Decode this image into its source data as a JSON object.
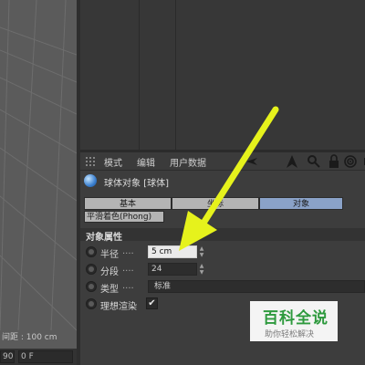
{
  "viewport": {
    "grid_spacing_label": "间距 : 100 cm",
    "bottom_left_value": "90",
    "frame_field": "0 F"
  },
  "attribute_manager": {
    "menu": [
      "模式",
      "编辑",
      "用户数据"
    ],
    "toolbar_icons": [
      "back-arrow-icon",
      "cursor-arrow-icon",
      "search-icon",
      "lock-icon",
      "target-icon",
      "add-icon"
    ],
    "object_title": "球体对象 [球体]",
    "tabs": {
      "basic": "基本",
      "coord": "坐标",
      "object": "对象"
    },
    "active_tab": "对象",
    "sub_tab": "平滑着色(Phong)",
    "section_title": "对象属性",
    "properties": {
      "radius": {
        "label": "半径",
        "dots": "....",
        "value": "5 cm"
      },
      "segments": {
        "label": "分段",
        "dots": "....",
        "value": "24"
      },
      "type": {
        "label": "类型",
        "dots": "....",
        "value": "标准"
      },
      "render_perfect": {
        "label": "理想渲染",
        "checked": "✔"
      }
    }
  },
  "watermark": {
    "main": "百科全说",
    "sub": "助你轻松解决"
  },
  "colors": {
    "active_tab": "#8aa2c8",
    "arrow": "#e6f21c",
    "watermark_green": "#2e9a3e"
  }
}
